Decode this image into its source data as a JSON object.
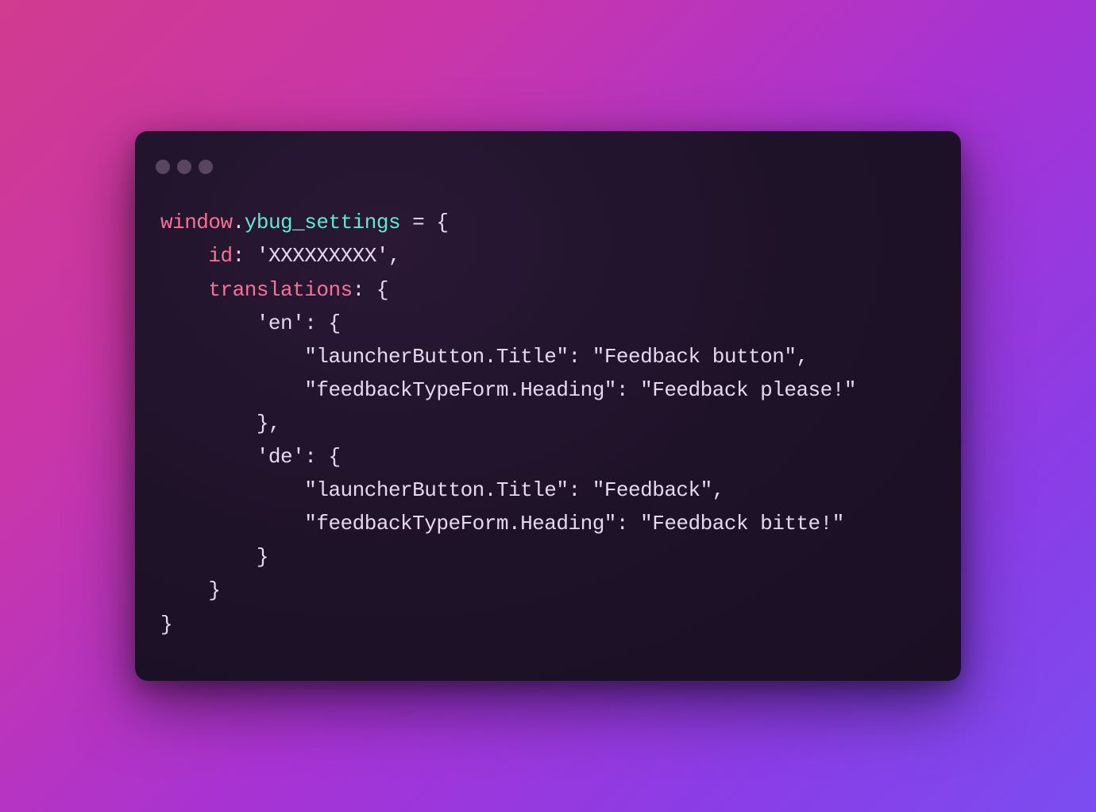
{
  "code": {
    "line1": {
      "window": "window",
      "dot": ".",
      "ybug_settings": "ybug_settings",
      "equals": " = ",
      "brace": "{"
    },
    "line2": {
      "indent": "    ",
      "id": "id",
      "colon": ": ",
      "value": "'XXXXXXXXX'",
      "comma": ","
    },
    "line3": {
      "indent": "    ",
      "translations": "translations",
      "colon": ": ",
      "brace": "{"
    },
    "line4": {
      "indent": "        ",
      "key": "'en'",
      "colon": ": ",
      "brace": "{"
    },
    "line5": {
      "indent": "            ",
      "key": "\"launcherButton.Title\"",
      "colon": ": ",
      "value": "\"Feedback button\"",
      "comma": ","
    },
    "line6": {
      "indent": "            ",
      "key": "\"feedbackTypeForm.Heading\"",
      "colon": ": ",
      "value": "\"Feedback please!\""
    },
    "line7": {
      "indent": "        ",
      "brace": "}",
      "comma": ","
    },
    "line8": {
      "indent": "        ",
      "key": "'de'",
      "colon": ": ",
      "brace": "{"
    },
    "line9": {
      "indent": "            ",
      "key": "\"launcherButton.Title\"",
      "colon": ": ",
      "value": "\"Feedback\"",
      "comma": ","
    },
    "line10": {
      "indent": "            ",
      "key": "\"feedbackTypeForm.Heading\"",
      "colon": ": ",
      "value": "\"Feedback bitte!\""
    },
    "line11": {
      "indent": "        ",
      "brace": "}"
    },
    "line12": {
      "indent": "    ",
      "brace": "}"
    },
    "line13": {
      "brace": "}"
    }
  }
}
